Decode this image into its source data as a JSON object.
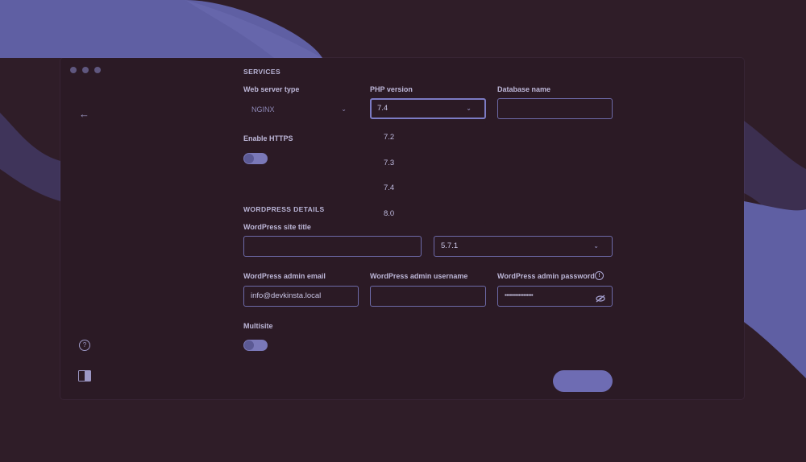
{
  "services": {
    "section_title": "SERVICES",
    "web_server_label": "Web server type",
    "web_server_value": "NGINX",
    "php_label": "PHP version",
    "php_value": "7.4",
    "php_options": [
      "7.2",
      "7.3",
      "7.4",
      "8.0"
    ],
    "database_label": "Database name",
    "database_value": "",
    "https_label": "Enable HTTPS"
  },
  "wordpress": {
    "section_title": "WORDPRESS DETAILS",
    "site_title_label": "WordPress site title",
    "site_title_value": "",
    "version_value": "5.7.1",
    "admin_email_label": "WordPress admin email",
    "admin_email_value": "info@devkinsta.local",
    "admin_username_label": "WordPress admin username",
    "admin_username_value": "",
    "admin_password_label": "WordPress admin password",
    "admin_password_value": "••••••••••••••••••",
    "multisite_label": "Multisite"
  },
  "colors": {
    "background": "#2f1d28",
    "accent": "#6e6cb3",
    "blob": "#5f5fa3"
  },
  "icons": [
    "back-arrow-icon",
    "help-icon",
    "sidebar-toggle-icon",
    "chevron-down-icon",
    "info-icon",
    "eye-slash-icon"
  ]
}
